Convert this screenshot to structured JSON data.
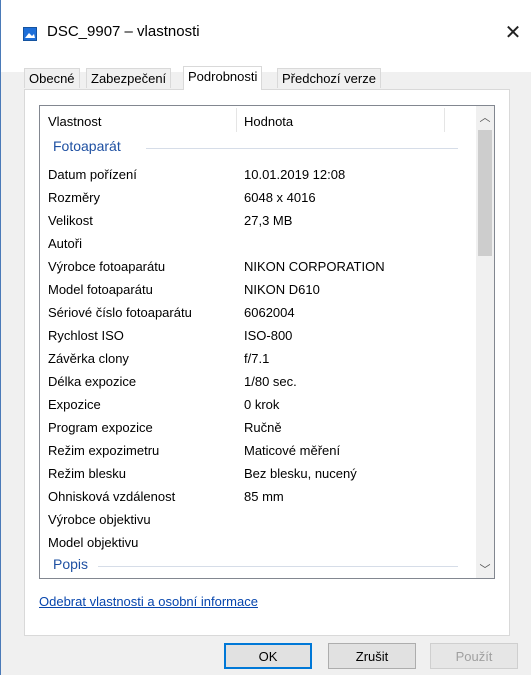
{
  "window": {
    "title": "DSC_9907 – vlastnosti"
  },
  "tabs": [
    {
      "label": "Obecné"
    },
    {
      "label": "Zabezpečení"
    },
    {
      "label": "Podrobnosti"
    },
    {
      "label": "Předchozí verze"
    }
  ],
  "list": {
    "col_property": "Vlastnost",
    "col_value": "Hodnota",
    "group_camera": "Fotoaparát",
    "group_description": "Popis",
    "rows": [
      {
        "name": "Datum pořízení",
        "value": "10.01.2019 12:08"
      },
      {
        "name": "Rozměry",
        "value": "6048 x 4016"
      },
      {
        "name": "Velikost",
        "value": "27,3 MB"
      },
      {
        "name": "Autoři",
        "value": ""
      },
      {
        "name": "Výrobce fotoaparátu",
        "value": "NIKON CORPORATION"
      },
      {
        "name": "Model fotoaparátu",
        "value": "NIKON D610"
      },
      {
        "name": "Sériové číslo fotoaparátu",
        "value": "6062004"
      },
      {
        "name": "Rychlost ISO",
        "value": "ISO-800"
      },
      {
        "name": "Závěrka clony",
        "value": "f/7.1"
      },
      {
        "name": "Délka expozice",
        "value": "1/80 sec."
      },
      {
        "name": "Expozice",
        "value": "0 krok"
      },
      {
        "name": "Program expozice",
        "value": "Ručně"
      },
      {
        "name": "Režim expozimetru",
        "value": "Maticové měření"
      },
      {
        "name": "Režim blesku",
        "value": "Bez blesku, nucený"
      },
      {
        "name": "Ohnisková vzdálenost",
        "value": "85 mm"
      },
      {
        "name": "Výrobce objektivu",
        "value": ""
      },
      {
        "name": "Model objektivu",
        "value": ""
      }
    ]
  },
  "remove_link": "Odebrat vlastnosti a osobní informace",
  "buttons": {
    "ok": "OK",
    "cancel": "Zrušit",
    "apply": "Použít"
  },
  "colors": {
    "group_text": "#1e50a2",
    "link": "#0645ad",
    "accent_border": "#0078d7"
  },
  "icons": {
    "title": "image-file-icon",
    "close": "close-icon"
  }
}
